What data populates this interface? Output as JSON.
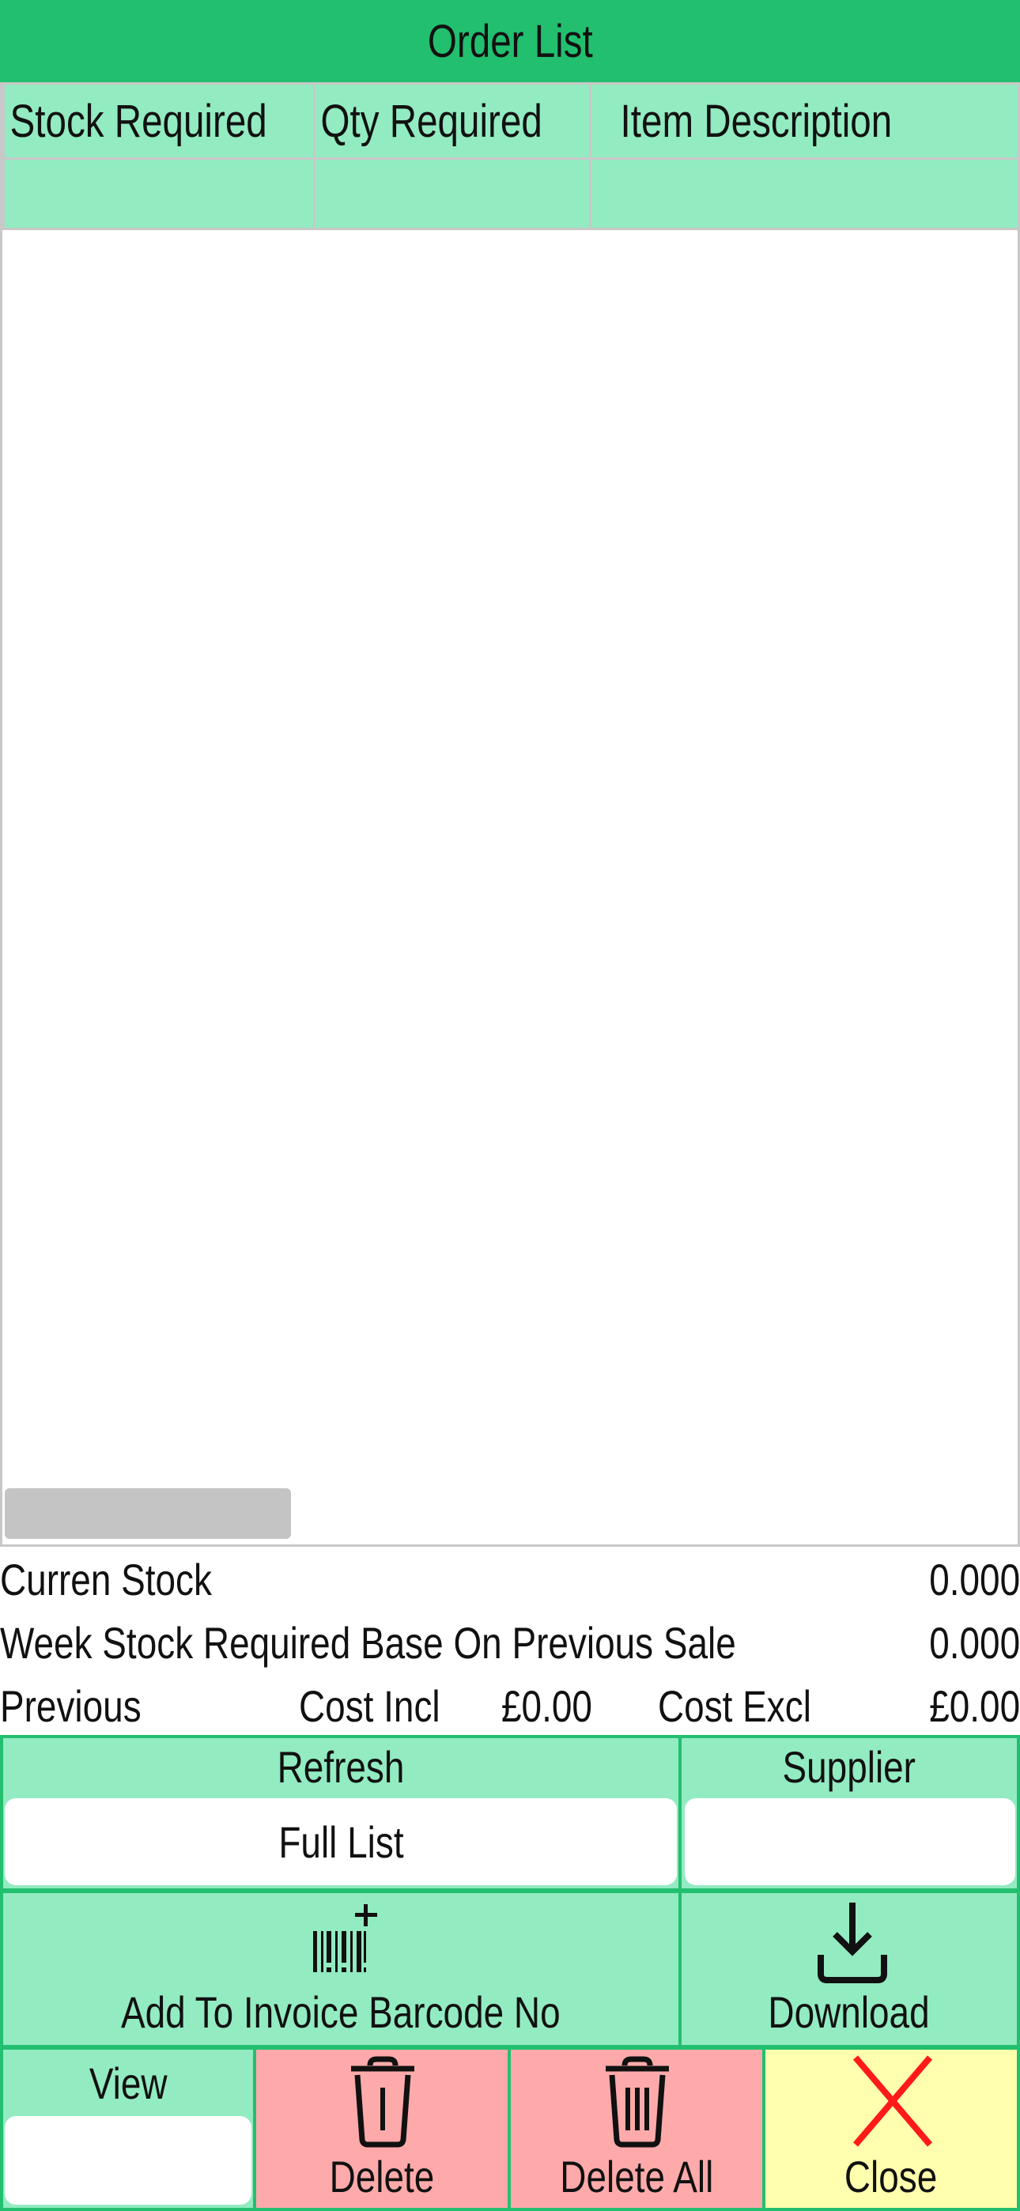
{
  "title": "Order List",
  "table": {
    "columns": [
      "Stock Required",
      "Qty Required",
      "Item Description"
    ],
    "rows": []
  },
  "info": {
    "current_stock_label": "Curren Stock",
    "current_stock_value": "0.000",
    "week_required_label": "Week Stock Required Base On Previous Sale",
    "week_required_value": "0.000",
    "previous_label": "Previous",
    "cost_incl_label": "Cost Incl",
    "cost_incl_value": "£0.00",
    "cost_excl_label": "Cost Excl",
    "cost_excl_value": "£0.00"
  },
  "refresh": {
    "label": "Refresh",
    "value": "Full List"
  },
  "supplier": {
    "label": "Supplier",
    "value": ""
  },
  "add_barcode": {
    "label": "Add To Invoice Barcode No",
    "icon": "barcode-plus-icon"
  },
  "download": {
    "label": "Download",
    "icon": "download-icon"
  },
  "view": {
    "label": "View",
    "value": ""
  },
  "delete": {
    "label": "Delete",
    "icon": "trash-icon"
  },
  "delete_all": {
    "label": "Delete All",
    "icon": "trash-all-icon"
  },
  "close": {
    "label": "Close",
    "icon": "close-x-icon",
    "color": "#ff1a1a"
  },
  "colors": {
    "accent": "#22bf6f",
    "light_green": "#93ebc1",
    "delete_bg": "#ffaaaa",
    "close_bg": "#ffffad"
  }
}
